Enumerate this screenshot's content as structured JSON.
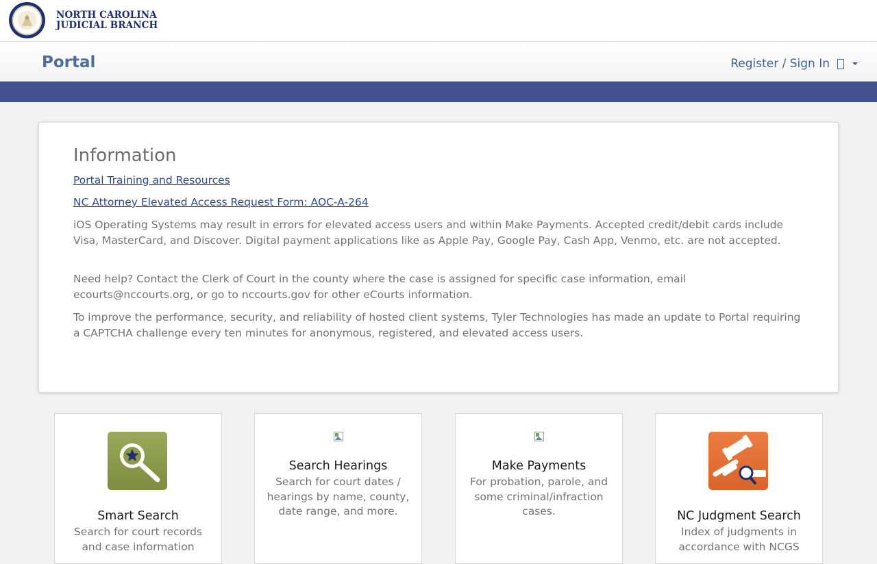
{
  "header": {
    "brand_line1": "NORTH CAROLINA",
    "brand_line2": "JUDICIAL BRANCH"
  },
  "navbar": {
    "title": "Portal",
    "signin_label": "Register / Sign In"
  },
  "info": {
    "title": "Information",
    "links": [
      "Portal Training and Resources",
      "NC Attorney Elevated Access Request Form: AOC-A-264"
    ],
    "paragraphs": [
      "iOS Operating Systems may result in errors for elevated access users and within Make Payments. Accepted credit/debit cards include Visa, MasterCard, and Discover. Digital payment applications like as Apple Pay, Google Pay, Cash App, Venmo, etc. are not accepted.",
      "Need help? Contact the Clerk of Court in the county where the case is assigned for specific case information, email ecourts@nccourts.org, or go to nccourts.gov for other eCourts information.",
      "To improve the performance, security, and reliability of hosted client systems, Tyler Technologies has made an update to Portal requiring a CAPTCHA challenge every ten minutes for anonymous, registered, and elevated access users."
    ]
  },
  "tiles": [
    {
      "title": "Smart Search",
      "description": "Search for court records and case information",
      "icon": "search-star-icon",
      "icon_color": "#8b9a4a"
    },
    {
      "title": "Search Hearings",
      "description": "Search for court dates / hearings by name, county, date range, and more.",
      "icon": "broken-image-icon"
    },
    {
      "title": "Make Payments",
      "description": "For probation, parole, and some criminal/infraction cases.",
      "icon": "broken-image-icon"
    },
    {
      "title": "NC Judgment Search",
      "description": "Index of judgments in accordance with NCGS",
      "icon": "gavel-search-icon",
      "icon_color": "#e06e35"
    }
  ],
  "colors": {
    "band": "#43518f",
    "link": "#2c4a8a",
    "portal_title": "#4b6e9a"
  }
}
